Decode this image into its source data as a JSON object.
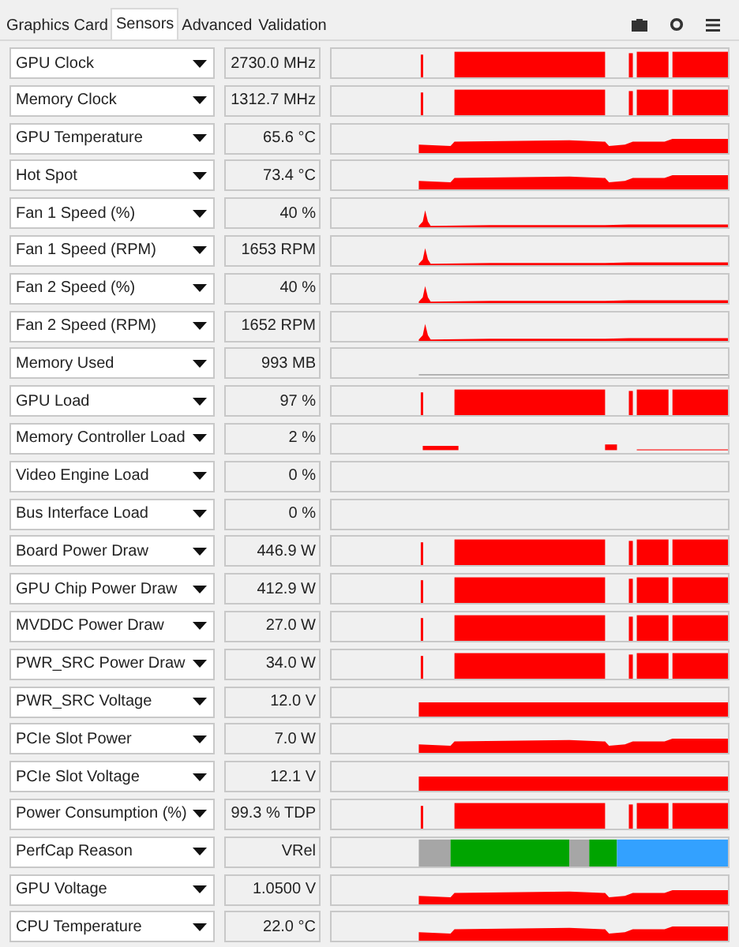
{
  "tabs": [
    {
      "label": "Graphics Card",
      "selected": false
    },
    {
      "label": "Sensors",
      "selected": true
    },
    {
      "label": "Advanced",
      "selected": false
    },
    {
      "label": "Validation",
      "selected": false
    }
  ],
  "sensors": [
    {
      "name": "GPU Clock",
      "value": "2730.0 MHz",
      "kind": "load"
    },
    {
      "name": "Memory Clock",
      "value": "1312.7 MHz",
      "kind": "load"
    },
    {
      "name": "GPU Temperature",
      "value": "65.6 °C",
      "kind": "level"
    },
    {
      "name": "Hot Spot",
      "value": "73.4 °C",
      "kind": "level"
    },
    {
      "name": "Fan 1 Speed (%)",
      "value": "40 %",
      "kind": "fan"
    },
    {
      "name": "Fan 1 Speed (RPM)",
      "value": "1653 RPM",
      "kind": "fan"
    },
    {
      "name": "Fan 2 Speed (%)",
      "value": "40 %",
      "kind": "fan"
    },
    {
      "name": "Fan 2 Speed (RPM)",
      "value": "1652 RPM",
      "kind": "fan"
    },
    {
      "name": "Memory Used",
      "value": "993 MB",
      "kind": "line"
    },
    {
      "name": "GPU Load",
      "value": "97 %",
      "kind": "load"
    },
    {
      "name": "Memory Controller Load",
      "value": "2 %",
      "kind": "sparse"
    },
    {
      "name": "Video Engine Load",
      "value": "0 %",
      "kind": "empty"
    },
    {
      "name": "Bus Interface Load",
      "value": "0 %",
      "kind": "empty"
    },
    {
      "name": "Board Power Draw",
      "value": "446.9 W",
      "kind": "load"
    },
    {
      "name": "GPU Chip Power Draw",
      "value": "412.9 W",
      "kind": "load"
    },
    {
      "name": "MVDDC Power Draw",
      "value": "27.0 W",
      "kind": "load"
    },
    {
      "name": "PWR_SRC Power Draw",
      "value": "34.0 W",
      "kind": "load"
    },
    {
      "name": "PWR_SRC Voltage",
      "value": "12.0 V",
      "kind": "flat"
    },
    {
      "name": "PCIe Slot Power",
      "value": "7.0 W",
      "kind": "level"
    },
    {
      "name": "PCIe Slot Voltage",
      "value": "12.1 V",
      "kind": "flat"
    },
    {
      "name": "Power Consumption (%)",
      "value": "99.3 % TDP",
      "kind": "load"
    },
    {
      "name": "PerfCap Reason",
      "value": "VRel",
      "kind": "perfcap"
    },
    {
      "name": "GPU Voltage",
      "value": "1.0500 V",
      "kind": "level"
    },
    {
      "name": "CPU Temperature",
      "value": "22.0 °C",
      "kind": "level"
    }
  ]
}
